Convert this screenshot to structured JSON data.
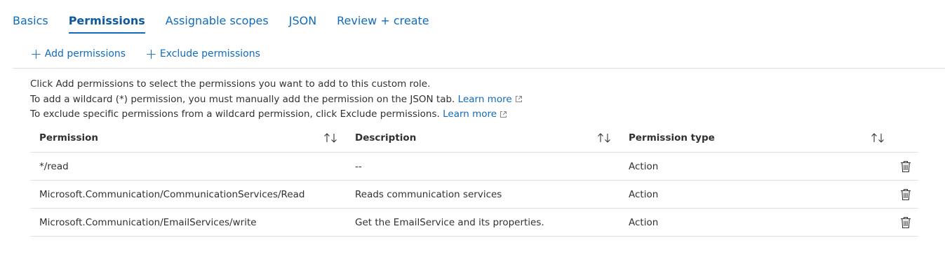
{
  "tabs": [
    {
      "label": "Basics",
      "active": false
    },
    {
      "label": "Permissions",
      "active": true
    },
    {
      "label": "Assignable scopes",
      "active": false
    },
    {
      "label": "JSON",
      "active": false
    },
    {
      "label": "Review + create",
      "active": false
    }
  ],
  "toolbar": {
    "add_label": "Add permissions",
    "exclude_label": "Exclude permissions",
    "icon": "plus-icon"
  },
  "info": {
    "line1": "Click Add permissions to select the permissions you want to add to this custom role.",
    "line2": "To add a wildcard (*) permission, you must manually add the permission on the JSON tab.",
    "line2_link": "Learn more",
    "line3": "To exclude specific permissions from a wildcard permission, click Exclude permissions.",
    "line3_link": "Learn more",
    "link_icon": "external-link-icon"
  },
  "table": {
    "columns": [
      "Permission",
      "Description",
      "Permission type"
    ],
    "sort_icon": "sort-icon",
    "delete_icon": "trash-icon",
    "rows": [
      {
        "permission": "*/read",
        "description": "--",
        "type": "Action"
      },
      {
        "permission": "Microsoft.Communication/CommunicationServices/Read",
        "description": "Reads communication services",
        "type": "Action"
      },
      {
        "permission": "Microsoft.Communication/EmailServices/write",
        "description": "Get the EmailService and its properties.",
        "type": "Action"
      }
    ]
  },
  "colors": {
    "accent": "#0f6cbd",
    "text": "#323130",
    "divider": "#e1dfdd"
  }
}
